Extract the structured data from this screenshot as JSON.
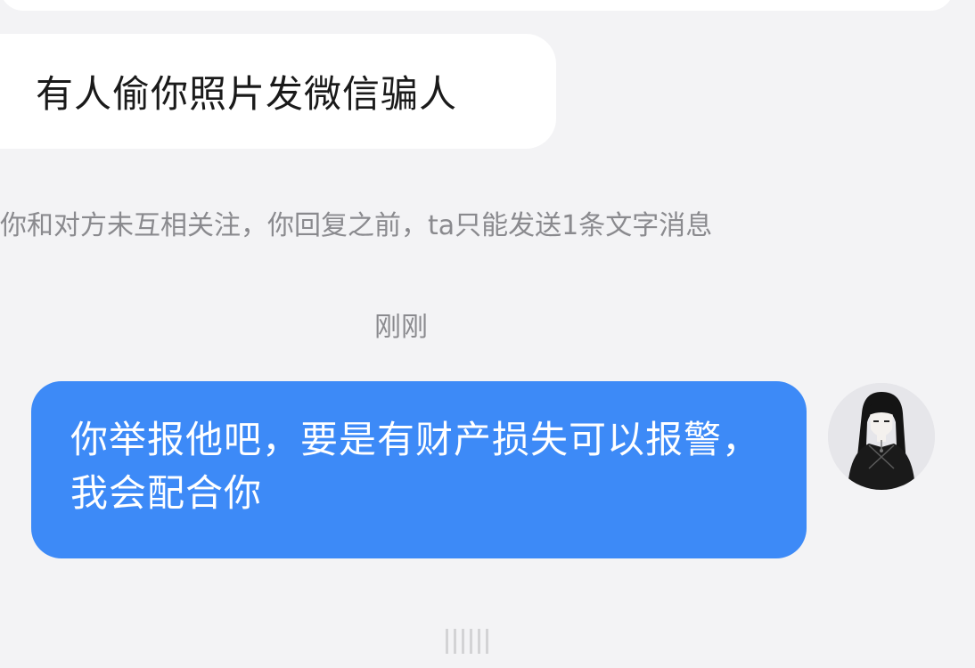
{
  "chat": {
    "incoming_message": "有人偷你照片发微信骗人",
    "system_notice": "你和对方未互相关注，你回复之前，ta只能发送1条文字消息",
    "timestamp": "刚刚",
    "outgoing_message": "你举报他吧，要是有财产损失可以报警，我会配合你"
  },
  "colors": {
    "background": "#f3f3f5",
    "incoming_bubble": "#ffffff",
    "outgoing_bubble": "#3d8af7",
    "secondary_text": "#8a8a8e"
  }
}
